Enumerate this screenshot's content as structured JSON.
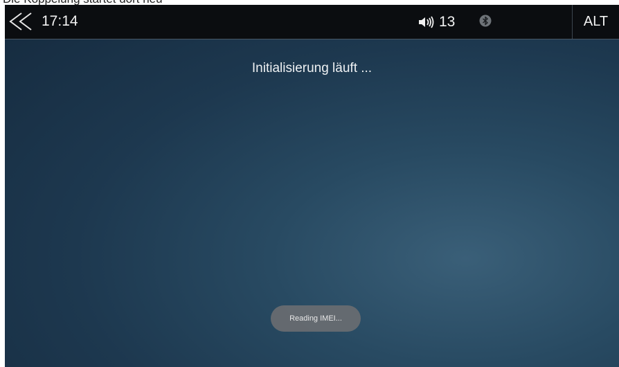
{
  "caption": {
    "text": "Die Koppelung startet dort neu"
  },
  "statusbar": {
    "time": "17:14",
    "volume_level": "13",
    "alt_label": "ALT",
    "icons": {
      "back": "double-chevron-left-icon",
      "volume": "speaker-icon",
      "bluetooth": "bluetooth-icon"
    }
  },
  "main": {
    "status_message": "Initialisierung läuft ...",
    "toast": "Reading IMEI..."
  },
  "colors": {
    "statusbar_bg": "#0b0d10",
    "screen_bg": "#1d384f",
    "toast_bg": "#696d71",
    "text": "#eef1f3"
  }
}
